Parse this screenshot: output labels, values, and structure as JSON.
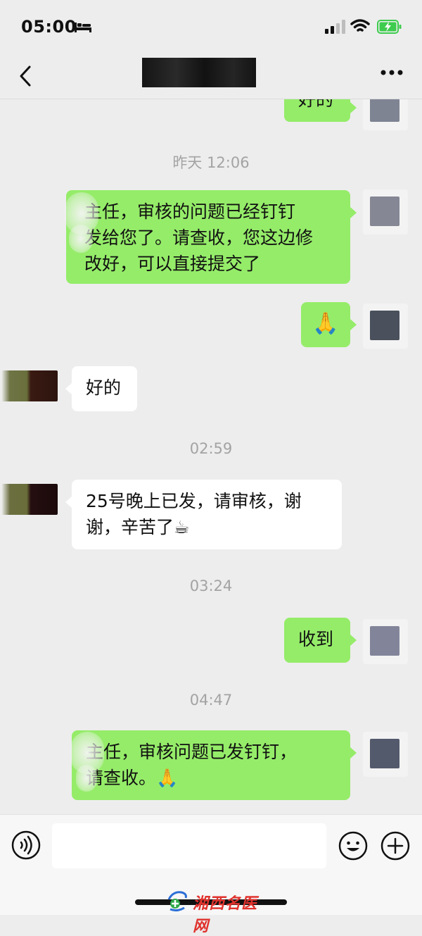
{
  "status_bar": {
    "time": "05:00"
  },
  "messages": [
    {
      "type": "out",
      "text": "好的"
    },
    {
      "type": "timestamp",
      "text": "昨天 12:06"
    },
    {
      "type": "out",
      "text": "主任，审核的问题已经钉钉\n发给您了。请查收，您这边修\n改好，可以直接提交了"
    },
    {
      "type": "out",
      "text": "🙏"
    },
    {
      "type": "in",
      "text": "好的"
    },
    {
      "type": "timestamp",
      "text": "02:59"
    },
    {
      "type": "in",
      "text": "25号晚上已发，请审核，谢\n谢，辛苦了☕"
    },
    {
      "type": "timestamp",
      "text": "03:24"
    },
    {
      "type": "out",
      "text": "收到"
    },
    {
      "type": "timestamp",
      "text": "04:47"
    },
    {
      "type": "out",
      "text": "主任，审核问题已发钉钉，\n请查收。🙏"
    }
  ],
  "watermark": {
    "text": "湘西名医网"
  },
  "icons": {
    "bed": "bed-icon",
    "signal": "signal-icon",
    "wifi": "wifi-icon",
    "battery": "battery-charging-icon",
    "back": "chevron-left-icon",
    "more": "more-dots-icon",
    "voice": "voice-icon",
    "emoji": "emoji-icon",
    "plus": "plus-icon"
  },
  "colors": {
    "out_bubble": "#95ec69",
    "in_bubble": "#ffffff",
    "background": "#ededed",
    "battery": "#3ecc4e"
  }
}
